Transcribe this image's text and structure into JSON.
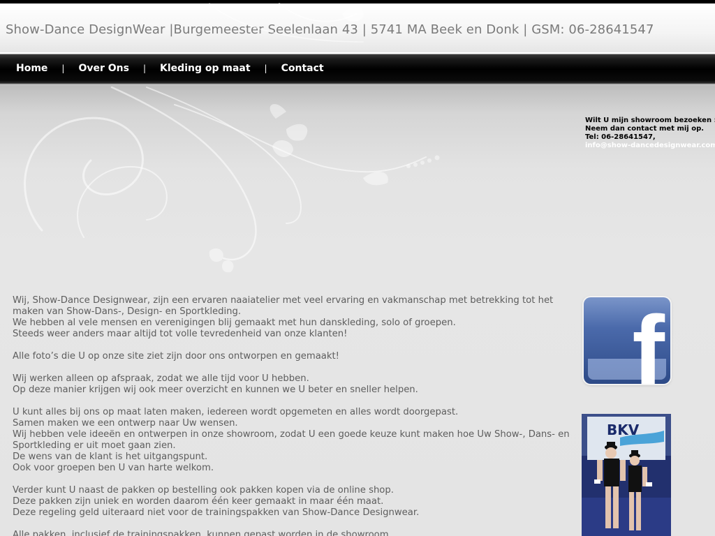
{
  "header": {
    "title": "Show-Dance DesignWear |Burgemeester Seelenlaan 43 | 5741 MA Beek en Donk | GSM: 06-28641547"
  },
  "nav": {
    "items": [
      {
        "label": "Home"
      },
      {
        "label": "Over Ons"
      },
      {
        "label": "Kleding op maat"
      },
      {
        "label": "Contact"
      }
    ],
    "separator": "|"
  },
  "sidebar": {
    "visit_line1": "Wilt U mijn showroom bezoeken :",
    "visit_line2": "Neem dan contact met mij op.",
    "visit_line3": "Tel: 06-28641547,",
    "email": "info@show-dancedesignwear.com",
    "facebook_glyph": "f",
    "photo_banner_text": "BKV"
  },
  "content": {
    "paragraphs": [
      [
        "Wij, Show-Dance Designwear, zijn een ervaren naaiatelier met veel ervaring en vakmanschap met betrekking tot het maken van Show-Dans-, Design- en Sportkleding.",
        "We hebben al vele mensen en verenigingen blij gemaakt met hun danskleding, solo of groepen.",
        "Steeds weer anders maar altijd tot volle tevredenheid van onze klanten!"
      ],
      [
        "Alle foto’s die U op onze site ziet zijn door ons ontworpen en gemaakt!"
      ],
      [
        "Wij werken alleen op afspraak, zodat we alle tijd voor U hebben.",
        "Op deze manier krijgen wij ook meer overzicht en kunnen we U beter en sneller helpen."
      ],
      [
        "U kunt alles bij ons op maat laten maken, iedereen wordt opgemeten en alles wordt doorgepast.",
        "Samen maken we een ontwerp naar Uw wensen.",
        "Wij hebben vele ideeën en ontwerpen in onze showroom, zodat U een goede keuze kunt maken hoe Uw Show-, Dans- en Sportkleding er uit moet gaan zien.",
        "De wens van de klant is het uitgangspunt.",
        "Ook voor groepen ben U van harte welkom."
      ],
      [
        "Verder kunt U naast de pakken op bestelling ook pakken kopen via de online shop.",
        "Deze pakken zijn uniek en worden daarom één keer gemaakt in maar één maat.",
        "Deze regeling geld uiteraard niet voor de trainingspakken van Show-Dance Designwear."
      ],
      [
        "Alle pakken, inclusief de trainingspakken, kunnen gepast worden in de showroom."
      ]
    ]
  }
}
